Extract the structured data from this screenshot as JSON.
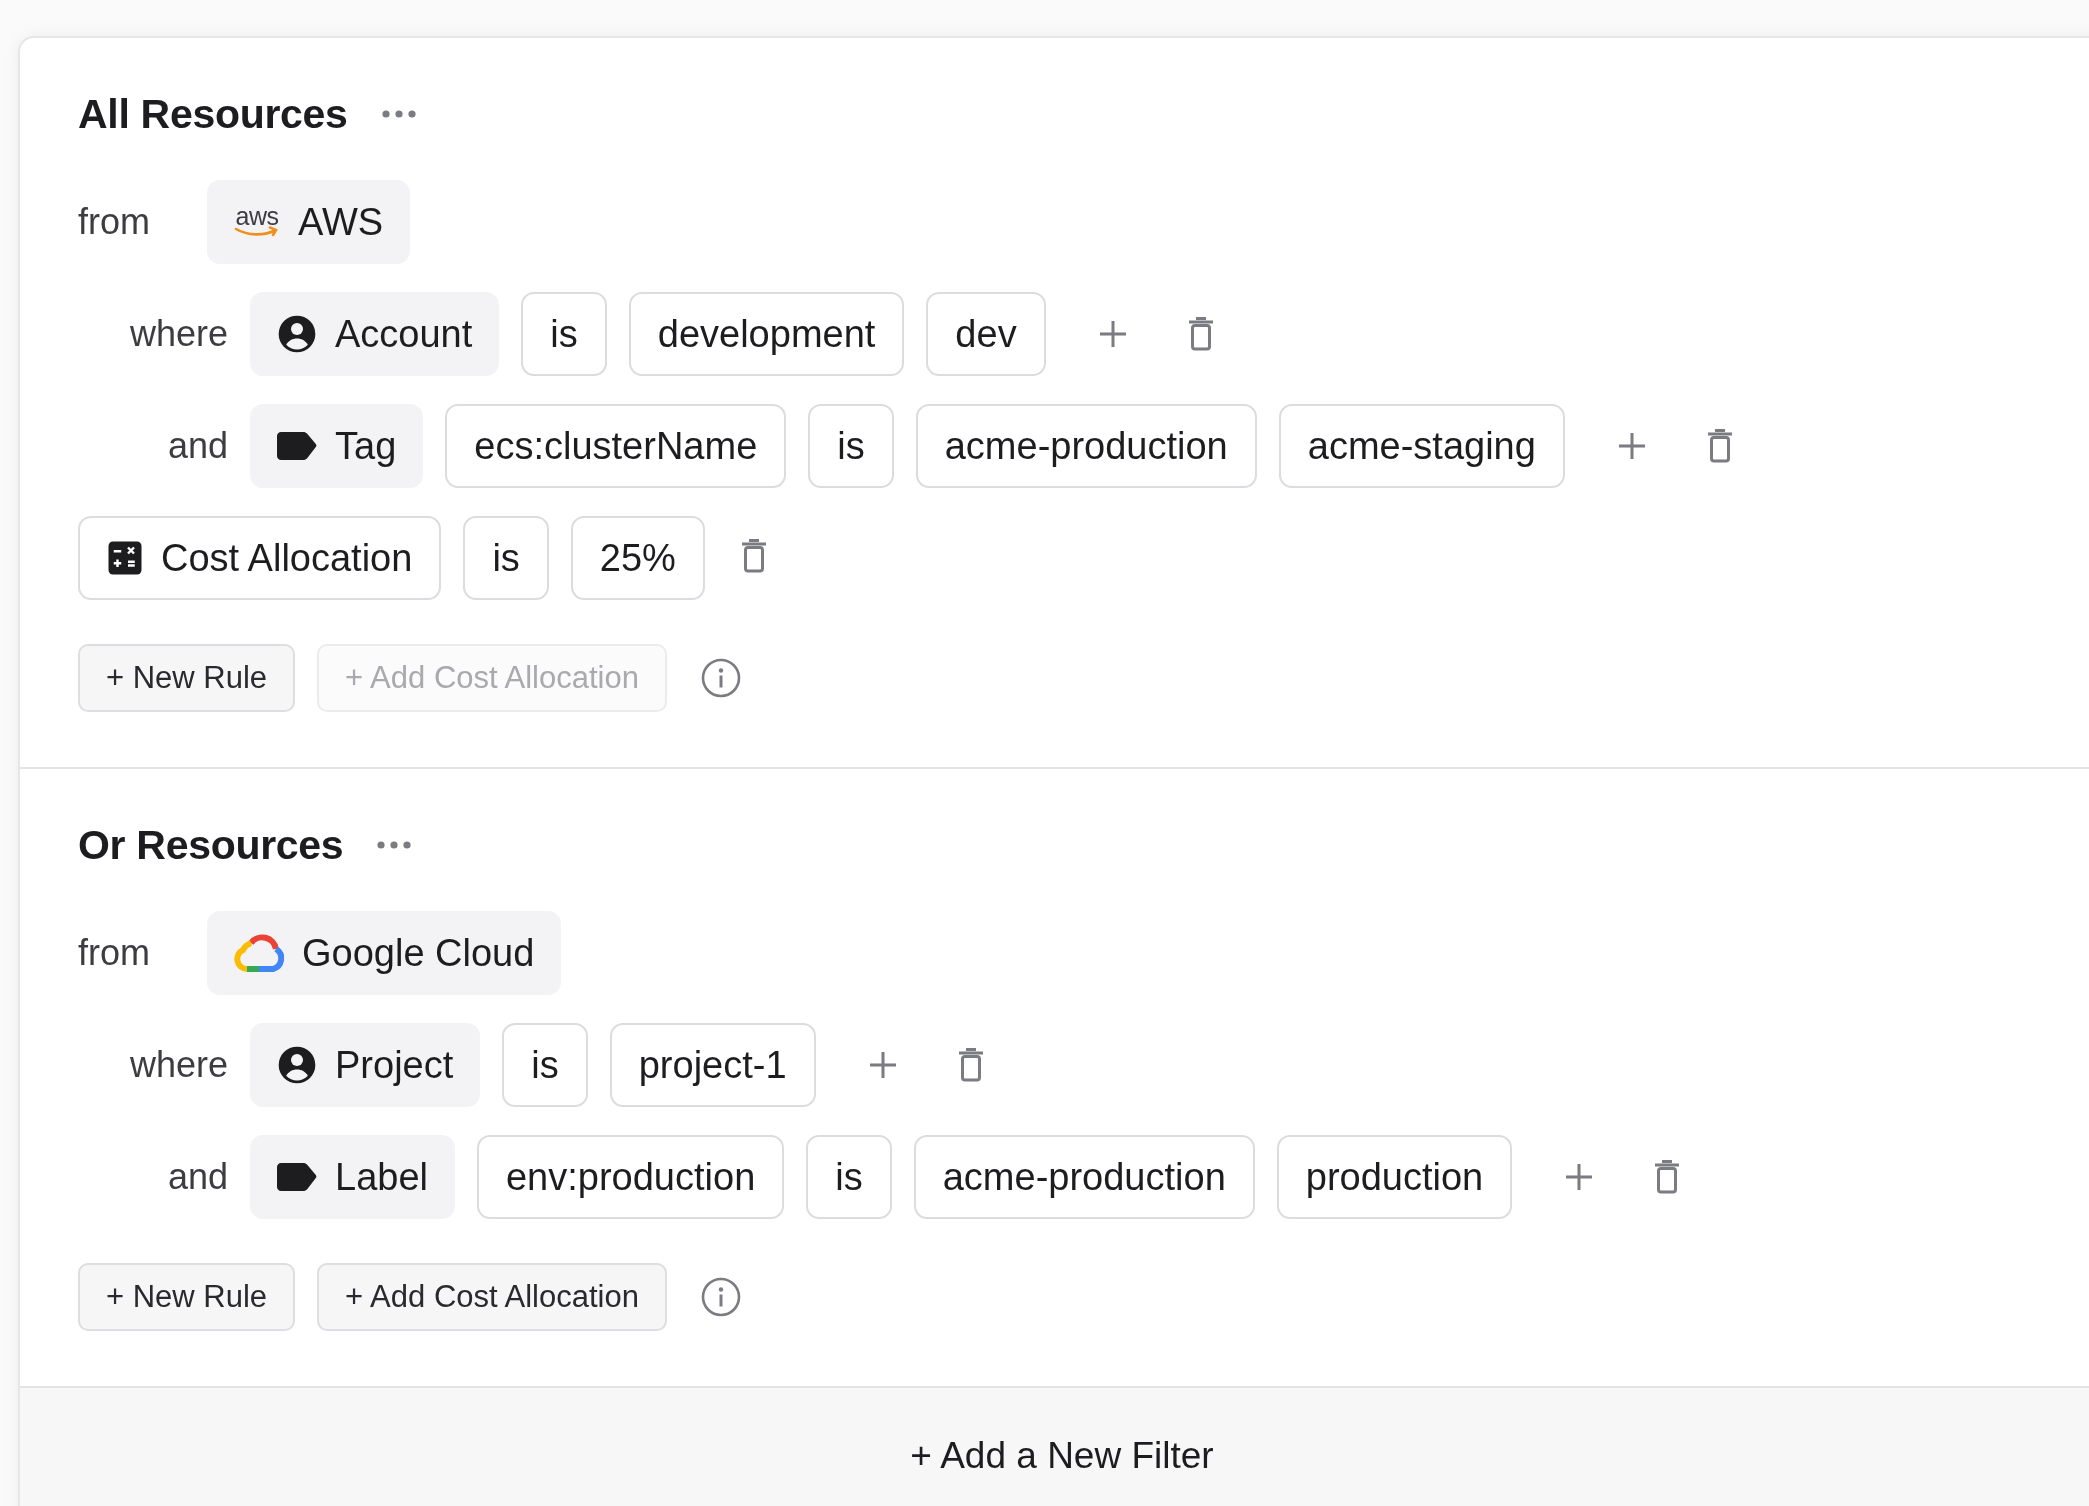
{
  "groups": [
    {
      "title": "All Resources",
      "source": {
        "label": "from",
        "name": "AWS",
        "logo": {
          "kind": "wordmark",
          "text": "aws"
        }
      },
      "rules": [
        {
          "conjunction": "where",
          "field": {
            "kind": "person",
            "label": "Account"
          },
          "operator": "is",
          "values": [
            "development",
            "dev"
          ]
        },
        {
          "conjunction": "and",
          "field": {
            "kind": "tag",
            "label": "Tag"
          },
          "key": "ecs:clusterName",
          "operator": "is",
          "values": [
            "acme-production",
            "acme-staging"
          ]
        }
      ],
      "allocation": {
        "label": "Cost Allocation",
        "operator": "is",
        "value": "25%"
      },
      "actions": [
        {
          "label": "+ New Rule",
          "disabled": false
        },
        {
          "label": "+ Add Cost Allocation",
          "disabled": true
        }
      ]
    },
    {
      "title": "Or Resources",
      "source": {
        "label": "from",
        "name": "Google Cloud",
        "logo": {
          "kind": "cloud"
        }
      },
      "rules": [
        {
          "conjunction": "where",
          "field": {
            "kind": "person",
            "label": "Project"
          },
          "operator": "is",
          "values": [
            "project-1"
          ]
        },
        {
          "conjunction": "and",
          "field": {
            "kind": "tag",
            "label": "Label"
          },
          "key": "env:production",
          "operator": "is",
          "values": [
            "acme-production",
            "production"
          ]
        }
      ],
      "actions": [
        {
          "label": "+ New Rule",
          "disabled": false
        },
        {
          "label": "+ Add Cost Allocation",
          "disabled": false
        }
      ]
    }
  ],
  "footer": {
    "label": "+ Add a New Filter"
  }
}
